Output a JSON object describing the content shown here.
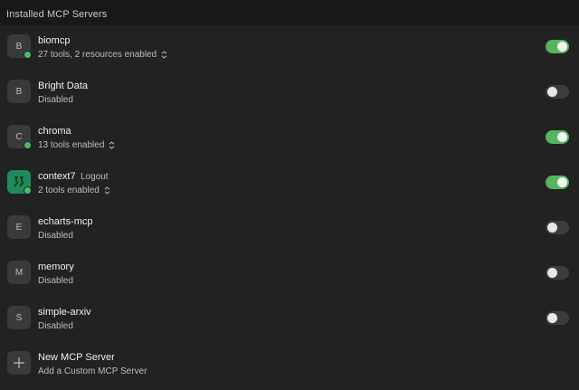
{
  "header": {
    "title": "Installed MCP Servers"
  },
  "servers": [
    {
      "initial": "B",
      "name": "biomcp",
      "subtitle": "27 tools, 2 resources enabled",
      "enabled": true,
      "expandable": true
    },
    {
      "initial": "B",
      "name": "Bright Data",
      "subtitle": "Disabled",
      "enabled": false,
      "expandable": false
    },
    {
      "initial": "C",
      "name": "chroma",
      "subtitle": "13 tools enabled",
      "enabled": true,
      "expandable": true
    },
    {
      "initial": "",
      "name": "context7",
      "subtitle": "2 tools enabled",
      "enabled": true,
      "expandable": true,
      "action_label": "Logout",
      "icon": "context7-logo-icon"
    },
    {
      "initial": "E",
      "name": "echarts-mcp",
      "subtitle": "Disabled",
      "enabled": false,
      "expandable": false
    },
    {
      "initial": "M",
      "name": "memory",
      "subtitle": "Disabled",
      "enabled": false,
      "expandable": false
    },
    {
      "initial": "S",
      "name": "simple-arxiv",
      "subtitle": "Disabled",
      "enabled": false,
      "expandable": false
    }
  ],
  "new_server": {
    "title": "New MCP Server",
    "subtitle": "Add a Custom MCP Server",
    "icon": "plus-icon"
  },
  "colors": {
    "toggle_on": "#55b45f",
    "status_dot": "#4dbd6a",
    "context7_brand": "#1f8a5b"
  }
}
